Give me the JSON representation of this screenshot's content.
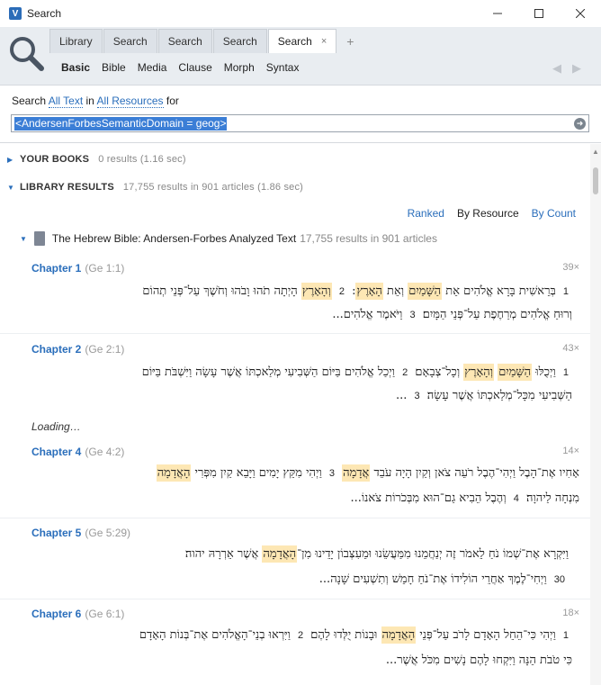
{
  "window": {
    "title": "Search",
    "app_icon": "V"
  },
  "tabs": [
    {
      "label": "Library"
    },
    {
      "label": "Search"
    },
    {
      "label": "Search"
    },
    {
      "label": "Search"
    },
    {
      "label": "Search",
      "close": "×"
    }
  ],
  "tab_add": "+",
  "subtabs": [
    "Basic",
    "Bible",
    "Media",
    "Clause",
    "Morph",
    "Syntax"
  ],
  "search": {
    "prefix": "Search",
    "scope1": "All Text",
    "in": "in",
    "scope2": "All Resources",
    "for": "for",
    "query": "<AndersenForbesSemanticDomain = geog>"
  },
  "your_books": {
    "label": "YOUR BOOKS",
    "count": "0 results (1.16 sec)"
  },
  "library_results": {
    "label": "LIBRARY RESULTS",
    "count": "17,755 results in 901 articles (1.86 sec)"
  },
  "sort": [
    "Ranked",
    "By Resource",
    "By Count"
  ],
  "resource": {
    "name": "The Hebrew Bible: Andersen-Forbes Analyzed Text",
    "meta": "17,755 results in 901 articles"
  },
  "chapters": [
    {
      "title": "Chapter 1",
      "ref": "(Ge 1:1)",
      "hits": "39×",
      "line1": [
        {
          "vn": "1"
        },
        {
          "t": " בְּרֵאשִׁית בָּרָא אֱלֹהִים אֵת "
        },
        {
          "hl": "הַשָּׁמַיִם"
        },
        {
          "t": " וְאֵת "
        },
        {
          "hl": "הָאָרֶץ"
        },
        {
          "t": ": "
        },
        {
          "vn": "2"
        },
        {
          "t": " "
        },
        {
          "hl": "וְהָאָרֶץ"
        },
        {
          "t": " הָיְתָה תֹהוּ וָבֹהוּ וְחֹשֶׁךְ עַל־פְּנֵי תְהוֹם"
        }
      ],
      "line2": [
        {
          "t": "וְרוּחַ אֱלֹהִים מְרַחֶפֶת עַל־פְּנֵי הַמָּיִם׃ "
        },
        {
          "vn": "3"
        },
        {
          "t": " וַיֹּאמֶר אֱלֹהִים..."
        }
      ]
    },
    {
      "title": "Chapter 2",
      "ref": "(Ge 2:1)",
      "hits": "43×",
      "line1": [
        {
          "vn": "1"
        },
        {
          "t": " וַיְכֻלּוּ "
        },
        {
          "hl": "הַשָּׁמַיִם"
        },
        {
          "t": " "
        },
        {
          "hl": "וְהָאָרֶץ"
        },
        {
          "t": " וְכָל־צְבָאָם׃ "
        },
        {
          "vn": "2"
        },
        {
          "t": " וַיְכַל אֱלֹהִים בַּיּוֹם הַשְּׁבִיעִי מְלַאכְתּוֹ אֲשֶׁר עָשָׂה וַיִּשְׁבֹּת בַּיּוֹם"
        }
      ],
      "line2": [
        {
          "t": "הַשְּׁבִיעִי מִכָּל־מְלַאכְתּוֹ אֲשֶׁר עָשָׂה׃ "
        },
        {
          "vn": "3"
        },
        {
          "t": " ..."
        }
      ]
    },
    {
      "title": "Chapter 4",
      "ref": "(Ge 4:2)",
      "hits": "14×",
      "line1": [
        {
          "t": "אָחִיו אֶת־הָבֶל וַיְהִי־הֶבֶל רֹעֵה צֹאן וְקַיִן הָיָה עֹבֵד "
        },
        {
          "hl": "אֲדָמָה"
        },
        {
          "t": "׃ "
        },
        {
          "vn": "3"
        },
        {
          "t": " וַיְהִי מִקֵּץ יָמִים וַיָּבֵא קַיִן מִפְּרִי "
        },
        {
          "hl": "הָאֲדָמָה"
        }
      ],
      "line2": [
        {
          "t": "מִנְחָה לַיהוָה׃ "
        },
        {
          "vn": "4"
        },
        {
          "t": " וְהֶבֶל הֵבִיא גַם־הוּא מִבְּכֹרוֹת צֹאנוֹ..."
        }
      ]
    },
    {
      "title": "Chapter 5",
      "ref": "(Ge 5:29)",
      "hits": "",
      "line1": [
        {
          "t": "וַיִּקְרָא אֶת־שְׁמוֹ נֹחַ לֵאמֹר זֶה יְנַחֲמֵנוּ מִמַּעֲשֵׂנוּ וּמֵעִצְּבוֹן יָדֵינוּ מִן־"
        },
        {
          "hl": "הָאֲדָמָה"
        },
        {
          "t": " אֲשֶׁר אֵרְרָהּ יהוה׃"
        }
      ],
      "line2": [
        {
          "vn": "30"
        },
        {
          "t": " וַיְחִי־לֶמֶךְ אַחֲרֵי הוֹלִידוֹ אֶת־נֹחַ חָמֵשׁ וְתִשְׁעִים שָׁנָה..."
        }
      ]
    },
    {
      "title": "Chapter 6",
      "ref": "(Ge 6:1)",
      "hits": "18×",
      "line1": [
        {
          "vn": "1"
        },
        {
          "t": " וַיְהִי כִּי־הֵחֵל הָאָדָם לָרֹב עַל־פְּנֵי "
        },
        {
          "hl": "הָאֲדָמָה"
        },
        {
          "t": " וּבָנוֹת יֻלְּדוּ לָהֶם׃ "
        },
        {
          "vn": "2"
        },
        {
          "t": " וַיִּרְאוּ בְנֵי־הָאֱלֹהִים אֶת־בְּנוֹת הָאָדָם"
        }
      ],
      "line2": [
        {
          "t": "כִּי טֹבֹת הֵנָּה וַיִּקְחוּ לָהֶם נָשִׁים מִכֹּל אֲשֶׁר..."
        }
      ]
    }
  ],
  "loading": "Loading…"
}
